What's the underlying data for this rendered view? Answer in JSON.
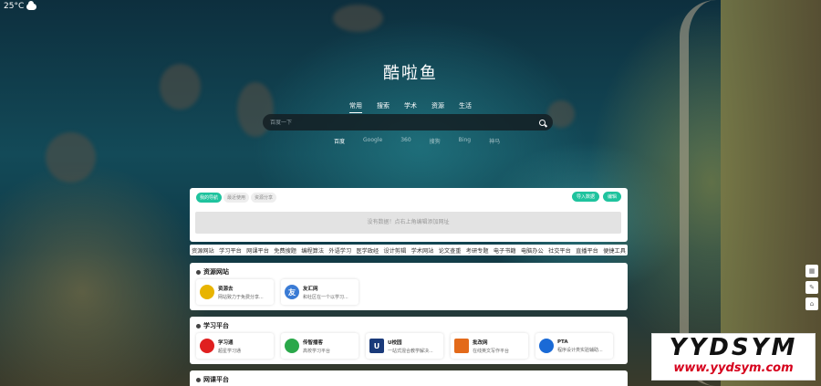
{
  "weather": {
    "temp": "25°C",
    "icon": "cloud-icon"
  },
  "site_title": "酷啦鱼",
  "categories": [
    {
      "label": "常用",
      "active": true
    },
    {
      "label": "搜索",
      "active": false
    },
    {
      "label": "学术",
      "active": false
    },
    {
      "label": "资源",
      "active": false
    },
    {
      "label": "生活",
      "active": false
    }
  ],
  "search": {
    "placeholder": "百度一下"
  },
  "engines": [
    {
      "label": "百度",
      "active": true
    },
    {
      "label": "Google",
      "active": false
    },
    {
      "label": "360",
      "active": false
    },
    {
      "label": "搜狗",
      "active": false
    },
    {
      "label": "Bing",
      "active": false
    },
    {
      "label": "神马",
      "active": false
    }
  ],
  "my_panel": {
    "tabs": [
      {
        "label": "我的导航",
        "active": true
      },
      {
        "label": "最近使用",
        "active": false
      },
      {
        "label": "资源分享",
        "active": false
      }
    ],
    "actions": [
      "导入数据",
      "编辑"
    ],
    "empty_text": "没有数据！点右上角编辑添加网址"
  },
  "nav_strip": [
    "资源网站",
    "学习平台",
    "网课平台",
    "免费搜题",
    "编程算法",
    "外语学习",
    "医学政经",
    "设计剪辑",
    "学术网站",
    "论文查重",
    "考研专题",
    "电子书籍",
    "电脑办公",
    "社交平台",
    "直播平台",
    "便捷工具"
  ],
  "sections": [
    {
      "title": "资源网站",
      "cards": [
        {
          "title": "资源去",
          "desc": "网站致力于免费分享...",
          "logo_text": "",
          "logo_color": "#e8b400"
        },
        {
          "title": "友汇网",
          "desc": "和社区在一个以学习...",
          "logo_text": "友",
          "logo_color": "#3a7bd5"
        }
      ]
    },
    {
      "title": "学习平台",
      "cards": [
        {
          "title": "学习通",
          "desc": "超星学习通",
          "logo_text": "",
          "logo_color": "#e02020"
        },
        {
          "title": "传智播客",
          "desc": "高校学习平台",
          "logo_text": "",
          "logo_color": "#2aa84a"
        },
        {
          "title": "U校园",
          "desc": "一站式混合教学解决...",
          "logo_text": "U",
          "logo_color": "#1a3a7a"
        },
        {
          "title": "批改网",
          "desc": "在线英文写作平台",
          "logo_text": "",
          "logo_color": "#e36a1a"
        },
        {
          "title": "PTA",
          "desc": "程序设计类实验辅助...",
          "logo_text": "",
          "logo_color": "#1a6ad6"
        }
      ]
    },
    {
      "title": "网课平台",
      "cards": []
    }
  ],
  "side_tools": [
    {
      "icon": "grid-icon",
      "glyph": "▦"
    },
    {
      "icon": "pen-icon",
      "glyph": "✎"
    },
    {
      "icon": "home-icon",
      "glyph": "⌂"
    }
  ],
  "watermark": {
    "big": "YYDSYM",
    "small": "www.yydsym.com"
  }
}
